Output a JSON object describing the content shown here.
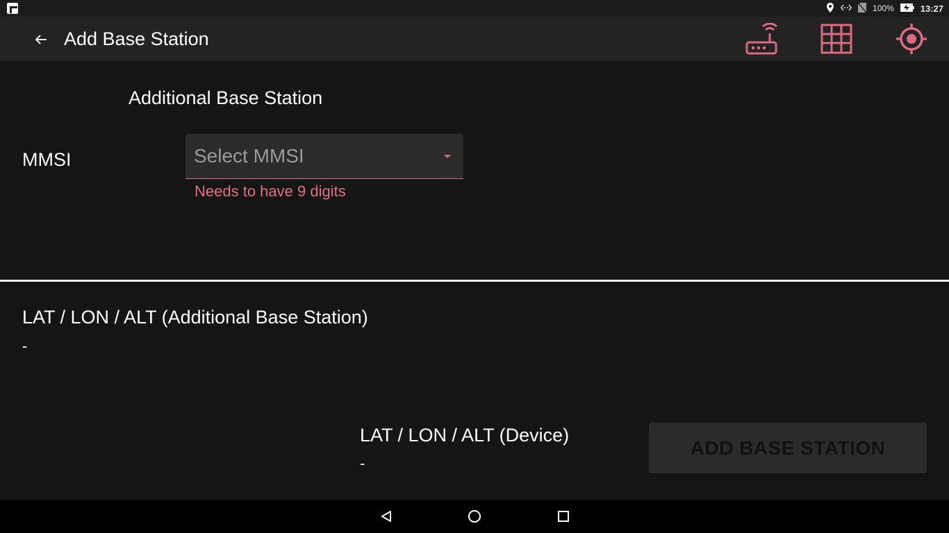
{
  "status_bar": {
    "battery_percent": "100%",
    "time": "13:27",
    "icons": [
      "app-notification-icon",
      "location-icon",
      "data-sync-icon",
      "no-sim-icon",
      "battery-charging-icon"
    ]
  },
  "app_bar": {
    "title": "Add Base Station",
    "back_icon": "arrow-left-icon",
    "actions": [
      "router-icon",
      "grid-icon",
      "crosshair-location-icon"
    ],
    "accent_color": "#d96b82"
  },
  "form": {
    "section_title": "Additional Base Station",
    "mmsi_label": "MMSI",
    "mmsi_placeholder": "Select MMSI",
    "mmsi_error": "Needs to have 9 digits"
  },
  "positions": {
    "additional_title": "LAT / LON / ALT (Additional Base Station)",
    "additional_value": "-",
    "device_title": "LAT / LON / ALT (Device)",
    "device_value": "-"
  },
  "actions": {
    "add_button_label": "ADD BASE STATION"
  },
  "nav_bar": {
    "buttons": [
      "back-triangle-icon",
      "home-circle-icon",
      "recents-square-icon"
    ]
  }
}
